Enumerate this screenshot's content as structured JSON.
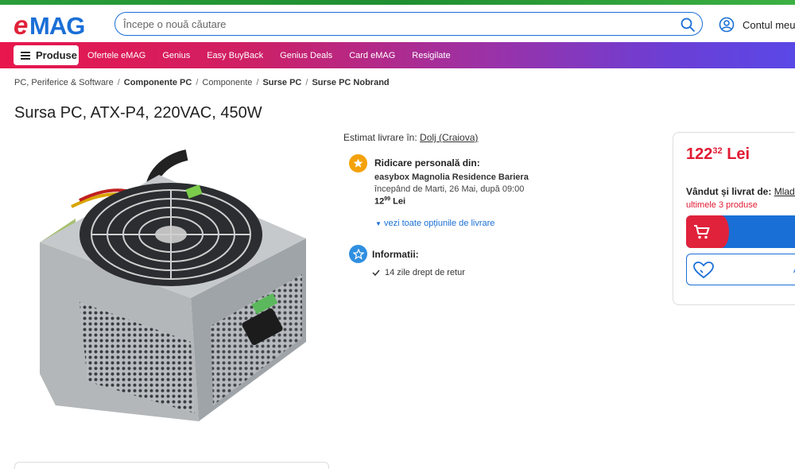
{
  "brand": {
    "logo_text": "eMAG",
    "logo_color": "#1a6fd6",
    "accent_red": "#e0223a"
  },
  "header": {
    "search_placeholder": "Începe o nouă căutare",
    "account_label": "Contul meu"
  },
  "nav": {
    "produse_label": "Produse",
    "items": [
      "Ofertele eMAG",
      "Genius",
      "Easy BuyBack",
      "Genius Deals",
      "Card eMAG",
      "Resigilate"
    ]
  },
  "breadcrumb": [
    "PC, Periferice & Software",
    "Componente PC",
    "Componente",
    "Surse PC",
    "Surse PC Nobrand"
  ],
  "product": {
    "title": "Sursa PC, ATX-P4, 220VAC, 450W"
  },
  "delivery": {
    "estimat_label": "Estimat livrare în:",
    "location": "Dolj (Craiova)",
    "pickup_title": "Ridicare personală din:",
    "pickup_name": "easybox Magnolia Residence Bariera",
    "pickup_date": "începând de Marti, 26 Mai, după 09:00",
    "pickup_cost_int": "12",
    "pickup_cost_dec": "99",
    "pickup_cost_currency": "Lei",
    "more_options": "vezi toate opțiunile de livrare",
    "info_title": "Informatii:",
    "return_policy": "14 zile drept de retur"
  },
  "buybox": {
    "price_int": "122",
    "price_dec": "32",
    "currency": "Lei",
    "seller_label": "Vândut și livrat de:",
    "seller_name": "Mlad T",
    "stock_text": "ultimele 3 produse",
    "fav_label": "A"
  }
}
